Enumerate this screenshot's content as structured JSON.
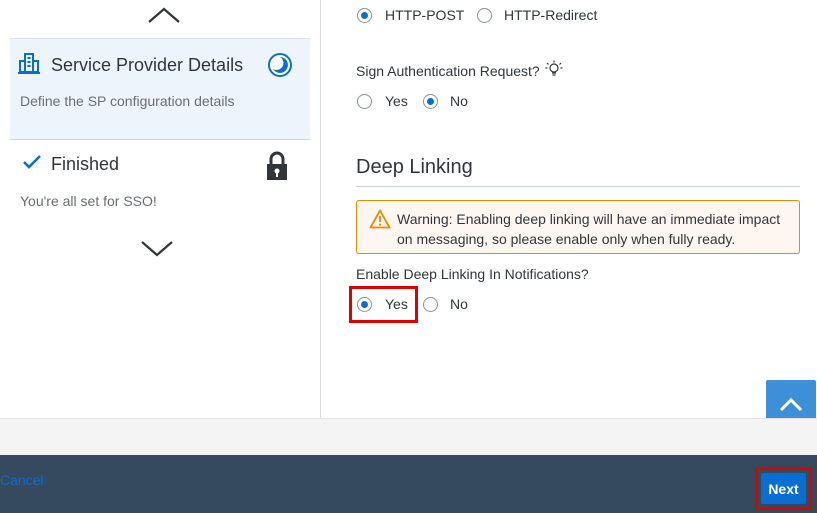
{
  "wizard": {
    "steps": [
      {
        "title": "Service Provider Details",
        "description": "Define the SP configuration details"
      },
      {
        "title": "Finished",
        "description": "You're all set for SSO!"
      }
    ]
  },
  "form": {
    "binding": {
      "options": [
        "HTTP-POST",
        "HTTP-Redirect"
      ],
      "selected": "HTTP-POST"
    },
    "sign_auth": {
      "label": "Sign Authentication Request?",
      "options": [
        "Yes",
        "No"
      ],
      "selected": "No"
    },
    "deep_linking": {
      "title": "Deep Linking",
      "warning": "Warning: Enabling deep linking will have an immediate impact on messaging, so please enable only when fully ready.",
      "enable_label": "Enable Deep Linking In Notifications?",
      "options": [
        "Yes",
        "No"
      ],
      "selected": "Yes"
    }
  },
  "footer": {
    "cancel_label": "Cancel",
    "next_label": "Next"
  },
  "colors": {
    "accent": "#0a6ed1",
    "footer_bg": "#354a5f",
    "highlight": "#e00000",
    "warning_border": "#e78c07"
  }
}
